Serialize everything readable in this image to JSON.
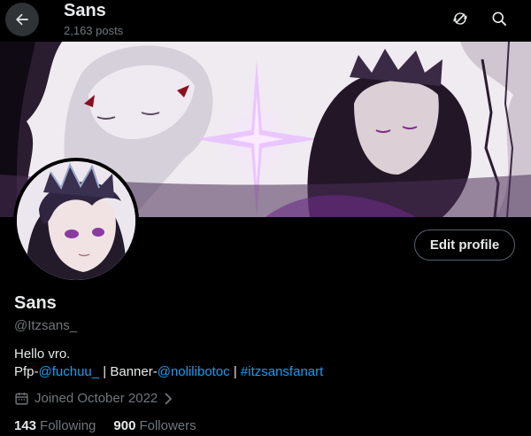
{
  "header": {
    "title": "Sans",
    "post_count": "2,163 posts"
  },
  "profile": {
    "edit_label": "Edit profile",
    "name": "Sans",
    "handle": "@Itzsans_",
    "bio_line1": "Hello vro.",
    "bio_pfp_prefix": "Pfp-",
    "bio_pfp_link": "@fuchuu_",
    "bio_sep1": " | Banner-",
    "bio_banner_link": "@nolilibotoc",
    "bio_sep2": " | ",
    "bio_hashtag": "#itzsansfanart",
    "joined": "Joined October 2022",
    "following_count": "143",
    "following_label": "Following",
    "followers_count": "900",
    "followers_label": "Followers"
  },
  "icons": {
    "back": "arrow-left-icon",
    "refresh": "refresh-icon",
    "search": "search-icon",
    "calendar": "calendar-icon",
    "chevron": "chevron-right-icon"
  },
  "colors": {
    "background": "#000000",
    "accent_link": "#1d9bf0",
    "muted_text": "#71767b",
    "primary_text": "#e7e9ea"
  }
}
